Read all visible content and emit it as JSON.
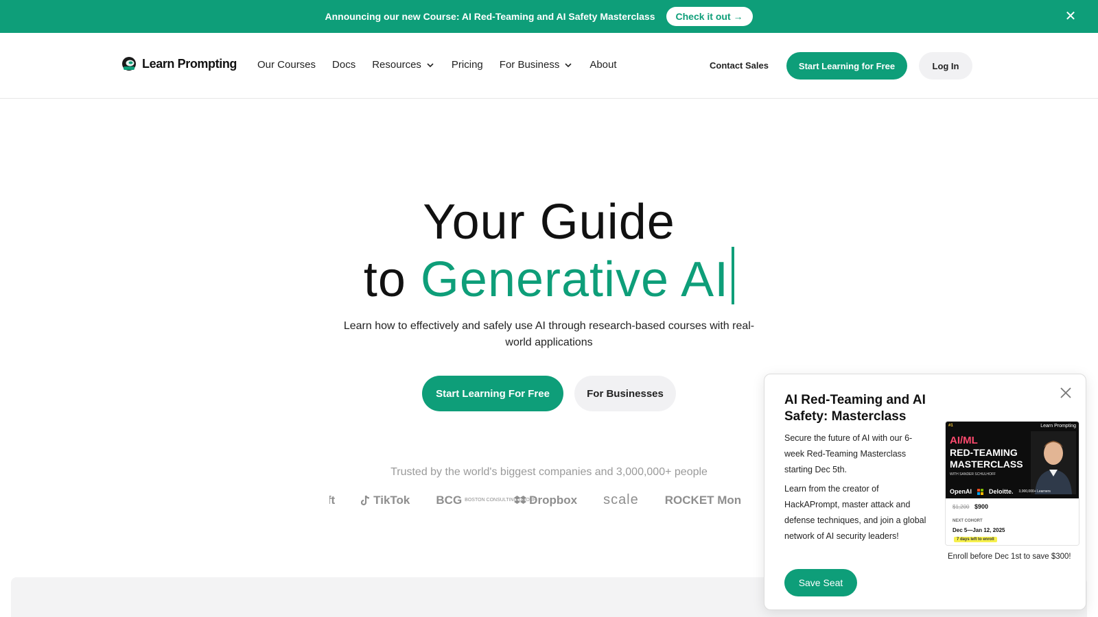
{
  "announcement": {
    "text": "Announcing our new Course: AI Red-Teaming and AI Safety Masterclass",
    "cta": "Check it out →",
    "close_glyph": "✕"
  },
  "nav": {
    "logo_text": "Learn Prompting",
    "links": [
      "Our Courses",
      "Docs",
      "Resources",
      "Pricing",
      "For Business",
      "About"
    ],
    "contact": "Contact Sales",
    "start": "Start Learning for Free",
    "login": "Log In"
  },
  "hero": {
    "title_line1": "Your Guide",
    "title_line2_prefix": "to ",
    "title_line2_accent": "Generative AI",
    "subtitle": "Learn how to effectively and safely use AI through research-based courses with real-world applications",
    "primary_button": "Start Learning For Free",
    "secondary_button": "For Businesses",
    "trusted": "Trusted by the world's biggest companies and 3,000,000+ people"
  },
  "trusted_logos": [
    "rosoft",
    "TikTok",
    "BCG",
    "BOSTON CONSULTING GROUP",
    "Dropbox",
    "scale",
    "ROCKET Mon"
  ],
  "promo": {
    "title": "AI Red-Teaming and AI Safety: Masterclass",
    "p1": "Secure the future of AI with our 6-week Red-Teaming Masterclass starting Dec 5th.",
    "p2": "Learn from the creator of HackAPrompt, master attack and defense techniques, and join a global network of AI security leaders!",
    "save_button": "Save Seat",
    "enroll_note": "Enroll before Dec 1st to save $300!",
    "card": {
      "badge": "#1",
      "brand": "Learn Prompting",
      "heading1": "AI/ML",
      "heading2": "RED-TEAMING MASTERCLASS",
      "with": "WITH SANDER SCHULHOFF",
      "logo1": "OpenAI",
      "logo2": "Deloitte.",
      "learners": "3,000,000+ Learners",
      "old_price": "$1,200",
      "new_price": "$900",
      "next_cohort": "NEXT COHORT",
      "dates": "Dec 5—Jan 12, 2025",
      "days_left": "7 days left to enroll"
    }
  },
  "colors": {
    "brand_green": "#0e9e79",
    "button_gray": "#f1f1f3",
    "muted_text": "#9a9a9a"
  }
}
